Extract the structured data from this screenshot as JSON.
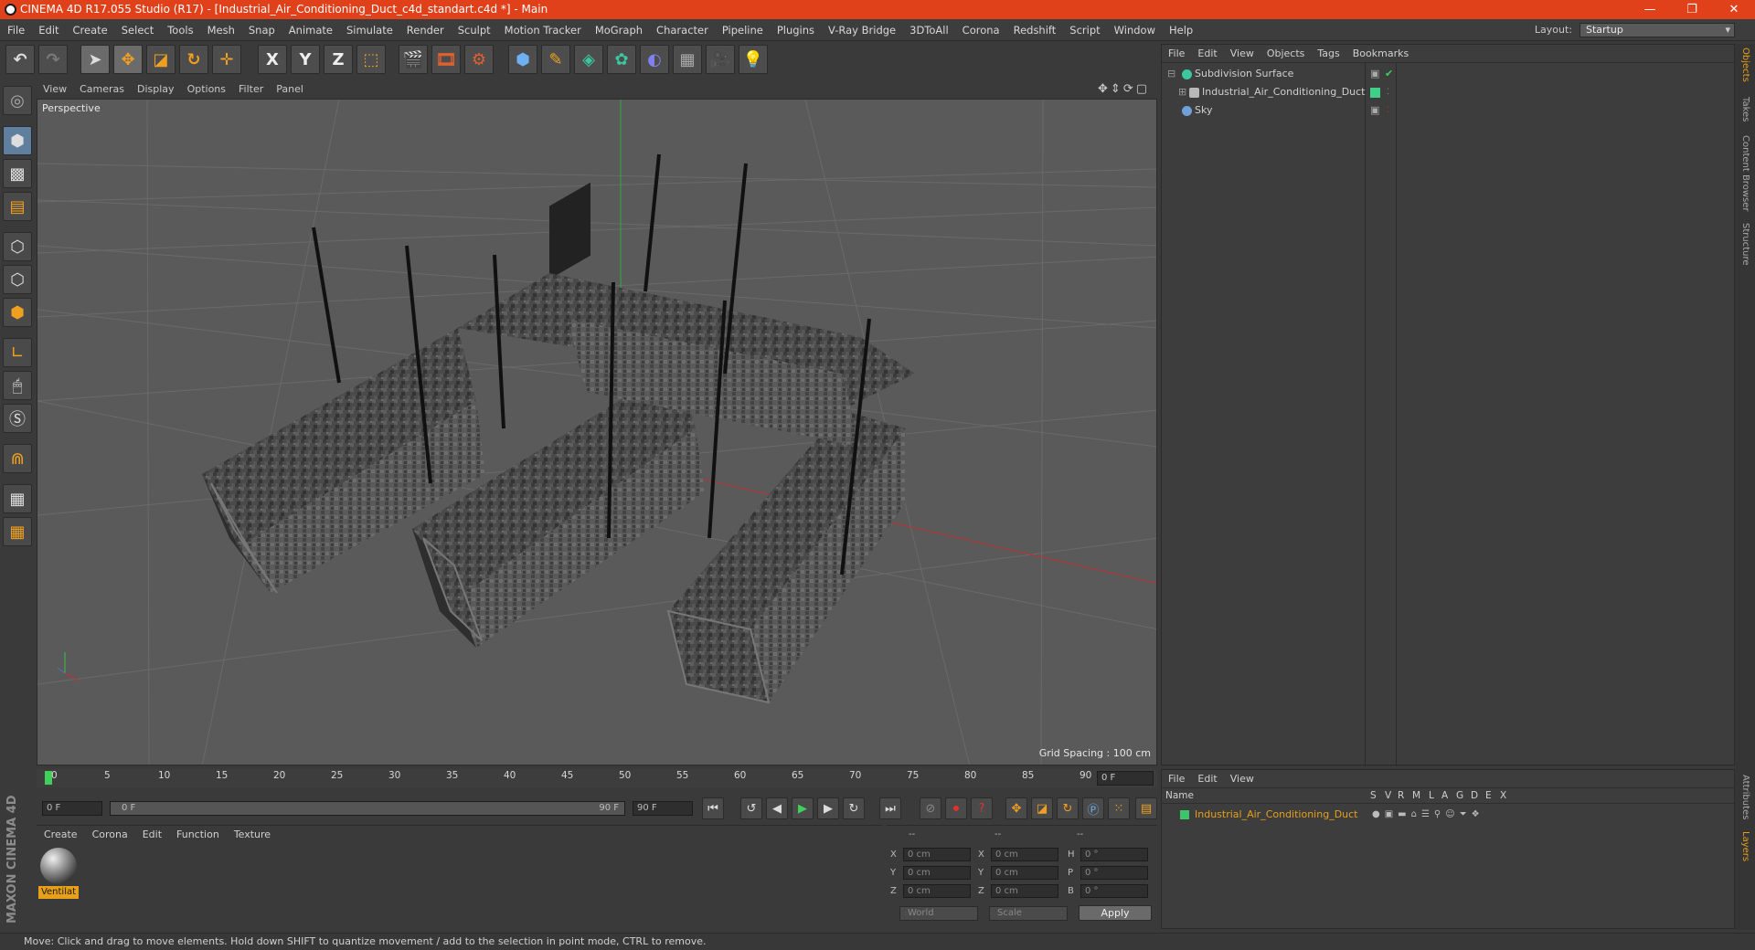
{
  "window": {
    "title": "CINEMA 4D R17.055 Studio (R17) - [Industrial_Air_Conditioning_Duct_c4d_standart.c4d *] - Main",
    "controls": [
      "—",
      "❐",
      "✕"
    ]
  },
  "menubar": {
    "items": [
      "File",
      "Edit",
      "Create",
      "Select",
      "Tools",
      "Mesh",
      "Snap",
      "Animate",
      "Simulate",
      "Render",
      "Sculpt",
      "Motion Tracker",
      "MoGraph",
      "Character",
      "Pipeline",
      "Plugins",
      "V-Ray Bridge",
      "3DToAll",
      "Corona",
      "Redshift",
      "Script",
      "Window",
      "Help"
    ],
    "layout_label": "Layout:",
    "layout_value": "Startup"
  },
  "toolbar": {
    "axis_x": "X",
    "axis_y": "Y",
    "axis_z": "Z"
  },
  "viewport": {
    "menu": [
      "View",
      "Cameras",
      "Display",
      "Options",
      "Filter",
      "Panel"
    ],
    "label": "Perspective",
    "grid_spacing": "Grid Spacing : 100 cm",
    "nav_icons": "✥⇕⟳▢"
  },
  "timeline": {
    "ticks": [
      "0",
      "5",
      "10",
      "15",
      "20",
      "25",
      "30",
      "35",
      "40",
      "45",
      "50",
      "55",
      "60",
      "65",
      "70",
      "75",
      "80",
      "85",
      "90"
    ],
    "current_frame": "0 F"
  },
  "transport": {
    "start_field": "0 F",
    "range_start": "0 F",
    "range_end": "90 F",
    "end_field": "90 F"
  },
  "material_panel": {
    "menu": [
      "Create",
      "Corona",
      "Edit",
      "Function",
      "Texture"
    ],
    "material_name": "Ventilat"
  },
  "coordinates": {
    "headers": [
      "--",
      "--",
      "--"
    ],
    "rows": [
      {
        "a": "X",
        "av": "0 cm",
        "b": "X",
        "bv": "0 cm",
        "c": "H",
        "cv": "0 °"
      },
      {
        "a": "Y",
        "av": "0 cm",
        "b": "Y",
        "bv": "0 cm",
        "c": "P",
        "cv": "0 °"
      },
      {
        "a": "Z",
        "av": "0 cm",
        "b": "Z",
        "bv": "0 cm",
        "c": "B",
        "cv": "0 °"
      }
    ],
    "mode_world": "World",
    "mode_scale": "Scale",
    "apply": "Apply"
  },
  "object_manager": {
    "menu": [
      "File",
      "Edit",
      "View",
      "Objects",
      "Tags",
      "Bookmarks"
    ],
    "objects": [
      {
        "name": "Subdivision Surface",
        "icon_color": "#3cc7a0"
      },
      {
        "name": "Industrial_Air_Conditioning_Duct",
        "icon_color": "#b8b8b8"
      },
      {
        "name": "Sky",
        "icon_color": "#6fa0d8"
      }
    ]
  },
  "layer_manager": {
    "menu": [
      "File",
      "Edit",
      "View"
    ],
    "columns": [
      "Name",
      "S",
      "V",
      "R",
      "M",
      "L",
      "A",
      "G",
      "D",
      "E",
      "X"
    ],
    "layer_name": "Industrial_Air_Conditioning_Duct",
    "layer_color": "#3ec46d"
  },
  "side_tabs": [
    "Objects",
    "Takes",
    "Content Browser",
    "Structure"
  ],
  "side_tabs_bottom": [
    "Attributes",
    "Layers"
  ],
  "status": "Move: Click and drag to move elements. Hold down SHIFT to quantize movement / add to the selection in point mode, CTRL to remove.",
  "brand": "MAXON CINEMA 4D"
}
